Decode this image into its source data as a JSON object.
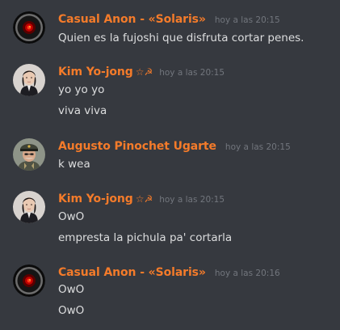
{
  "messages": [
    {
      "author": "Casual Anon - «Solaris»",
      "author_icon": "",
      "avatar": "hal9000-avatar",
      "time": "hoy a las 20:15",
      "lines": [
        "Quien es la fujoshi que disfruta cortar penes."
      ]
    },
    {
      "author": "Kim Yo-jong",
      "author_icon": "☆☭",
      "avatar": "portrait-woman-avatar",
      "time": "hoy a las 20:15",
      "lines": [
        "yo yo yo",
        "viva viva"
      ]
    },
    {
      "author": "Augusto Pinochet Ugarte",
      "author_icon": "",
      "avatar": "portrait-officer-avatar",
      "time": "hoy a las 20:15",
      "lines": [
        "k wea"
      ]
    },
    {
      "author": "Kim Yo-jong",
      "author_icon": "☆☭",
      "avatar": "portrait-woman-avatar",
      "time": "hoy a las 20:15",
      "lines": [
        "OwO",
        "empresta la pichula pa' cortarla"
      ]
    },
    {
      "author": "Casual Anon - «Solaris»",
      "author_icon": "",
      "avatar": "hal9000-avatar",
      "time": "hoy a las 20:16",
      "lines": [
        "OwO",
        "OwO"
      ]
    }
  ],
  "colors": {
    "background": "#36393f",
    "author": "#f47b2a",
    "timestamp": "#72767d",
    "text": "#dcddde"
  }
}
